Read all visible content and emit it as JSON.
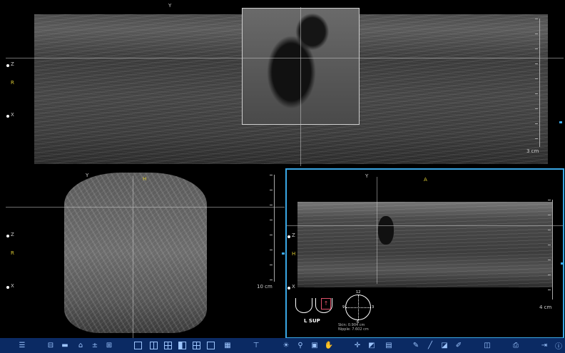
{
  "top_pane": {
    "label_top": "Y",
    "label_z": "Z",
    "label_r": "R",
    "label_x": "X",
    "scale": "3 cm"
  },
  "bottom_left_pane": {
    "label_top": "Y",
    "label_h": "H",
    "label_z": "Z",
    "label_r": "R",
    "label_x": "X",
    "scale": "10 cm"
  },
  "bottom_right_pane": {
    "label_top": "Y",
    "label_a": "A",
    "label_z": "Z",
    "label_h": "H",
    "label_x": "X",
    "scale": "4 cm",
    "body_marker": {
      "label": "L SUP",
      "probe_icon": "↑",
      "clock_12": "12",
      "clock_3": "3",
      "clock_6": "6",
      "clock_9": "9",
      "skin_text": "Skin:   0.904 cm",
      "nipple_text": "Nipple:  7.602 cm"
    }
  },
  "colors": {
    "active_border": "#3aa7e6",
    "toolbar_bg": "#0b2a63",
    "axis_yellow": "#d9c832",
    "probe_marker": "#e0506a"
  },
  "toolbar": {
    "icons": [
      "list-icon",
      "zoom-out-icon",
      "minus-icon",
      "home-icon",
      "plus-minus-icon",
      "zoom-in-icon",
      "layout-1-icon",
      "layout-2-icon",
      "layout-4-icon",
      "layout-split-icon",
      "layout-3-icon",
      "layout-single-icon",
      "layout-wide-icon",
      "reset-icon",
      "rotate-icon",
      "brightness-icon",
      "magnify-icon",
      "capture-icon",
      "probe-icon",
      "crosshair-icon",
      "measure-icon",
      "annotate-icon",
      "brush-icon",
      "pencil-icon",
      "erase-icon",
      "edit-icon",
      "image-icon",
      "print-icon",
      "exit-icon",
      "info-icon"
    ]
  }
}
